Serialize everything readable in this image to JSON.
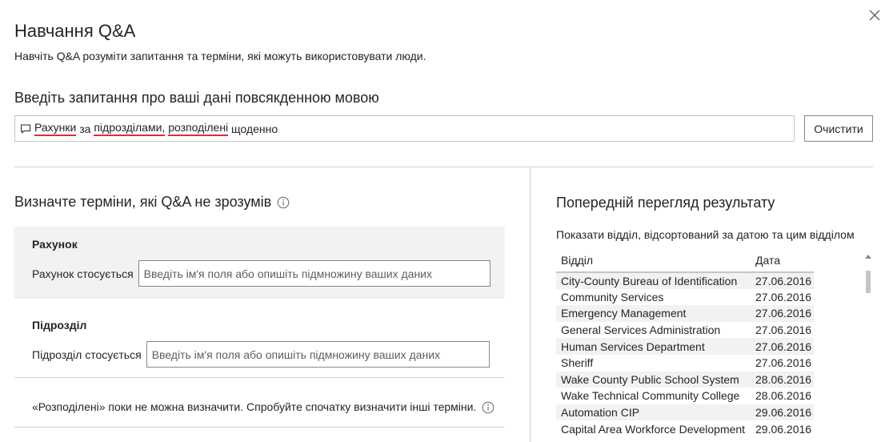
{
  "header": {
    "title": "Навчання Q&A",
    "subtitle": "Навчіть Q&A розуміти запитання та терміни, які можуть використовувати люди."
  },
  "question": {
    "label": "Введіть запитання про ваші дані повсякденною мовою",
    "tokens": [
      {
        "text": "Рахунки",
        "flagged": true
      },
      {
        "text": " за ",
        "flagged": false
      },
      {
        "text": "підрозділами,",
        "flagged": true
      },
      {
        "text": " ",
        "flagged": false
      },
      {
        "text": "розподілені",
        "flagged": true
      },
      {
        "text": " щоденно",
        "flagged": false
      }
    ],
    "clear_label": "Очистити"
  },
  "define": {
    "title": "Визначте терміни, які Q&A не зрозумів",
    "terms": [
      {
        "name": "Рахунок",
        "relation": "Рахунок стосується",
        "placeholder": "Введіть ім'я поля або опишіть підмножину ваших даних"
      },
      {
        "name": "Підрозділ",
        "relation": "Підрозділ стосується",
        "placeholder": "Введіть ім'я поля або опишіть підмножину ваших даних"
      }
    ],
    "note": "«Розподілені» поки не можна визначити. Спробуйте спочатку визначити інші терміни."
  },
  "preview": {
    "title": "Попередній перегляд результату",
    "subtitle": "Показати відділ, відсортований за датою та цим відділом",
    "columns": [
      "Відділ",
      "Дата"
    ],
    "rows": [
      [
        "City-County Bureau of Identification",
        "27.06.2016"
      ],
      [
        "Community Services",
        "27.06.2016"
      ],
      [
        "Emergency Management",
        "27.06.2016"
      ],
      [
        "General Services Administration",
        "27.06.2016"
      ],
      [
        "Human Services Department",
        "27.06.2016"
      ],
      [
        "Sheriff",
        "27.06.2016"
      ],
      [
        "Wake County Public School System",
        "28.06.2016"
      ],
      [
        "Wake Technical Community College",
        "28.06.2016"
      ],
      [
        "Automation CIP",
        "29.06.2016"
      ],
      [
        "Capital Area Workforce Development",
        "29.06.2016"
      ]
    ]
  },
  "icons": {
    "close": "close-icon",
    "chat": "chat-bubble-icon",
    "info": "info-icon"
  },
  "colors": {
    "error_underline": "#d13438",
    "row_stripe": "#f3f2f1",
    "border": "#8a8886"
  }
}
